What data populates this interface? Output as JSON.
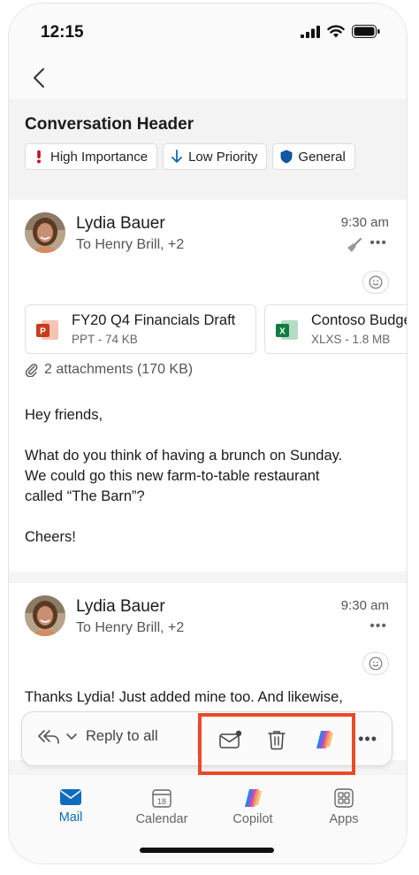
{
  "status_bar": {
    "time": "12:15"
  },
  "conversation": {
    "title": "Conversation Header",
    "tags": [
      {
        "label": "High Importance",
        "icon": "exclamation-icon",
        "color": "#c50f1f"
      },
      {
        "label": "Low Priority",
        "icon": "arrow-down-icon",
        "color": "#0f6cbd"
      },
      {
        "label": "General",
        "icon": "shield-icon",
        "color": "#0f5aa8"
      }
    ]
  },
  "messages": [
    {
      "sender": "Lydia Bauer",
      "recipients": "To Henry Brill, +2",
      "time": "9:30 am",
      "attachments": [
        {
          "name": "FY20 Q4 Financials Draft",
          "meta": "PPT - 74 KB",
          "icon": "powerpoint-icon",
          "color": "#c43e1c"
        },
        {
          "name": "Contoso Budget",
          "meta": "XLXS - 1.8 MB",
          "icon": "excel-icon",
          "color": "#107c41"
        }
      ],
      "attachment_summary": "2 attachments (170 KB)",
      "body": {
        "greeting": "Hey friends,",
        "line1": "What do you think of having a brunch on Sunday.",
        "line2": "We could go this new farm-to-table restaurant",
        "line3": "called “The Barn”?",
        "signoff": "Cheers!"
      }
    },
    {
      "sender": "Lydia Bauer",
      "recipients": "To Henry Brill, +2",
      "time": "9:30 am",
      "body": {
        "line1": "Thanks Lydia! Just added mine too. And likewise,"
      }
    }
  ],
  "action_bar": {
    "reply_label": "Reply to all"
  },
  "tabs": [
    {
      "label": "Mail",
      "icon": "mail-icon",
      "active": true
    },
    {
      "label": "Calendar",
      "icon": "calendar-icon",
      "badge": "18"
    },
    {
      "label": "Copilot",
      "icon": "copilot-icon"
    },
    {
      "label": "Apps",
      "icon": "apps-icon"
    }
  ],
  "colors": {
    "accent": "#0f6cbd",
    "highlight": "#ea4a2a"
  }
}
